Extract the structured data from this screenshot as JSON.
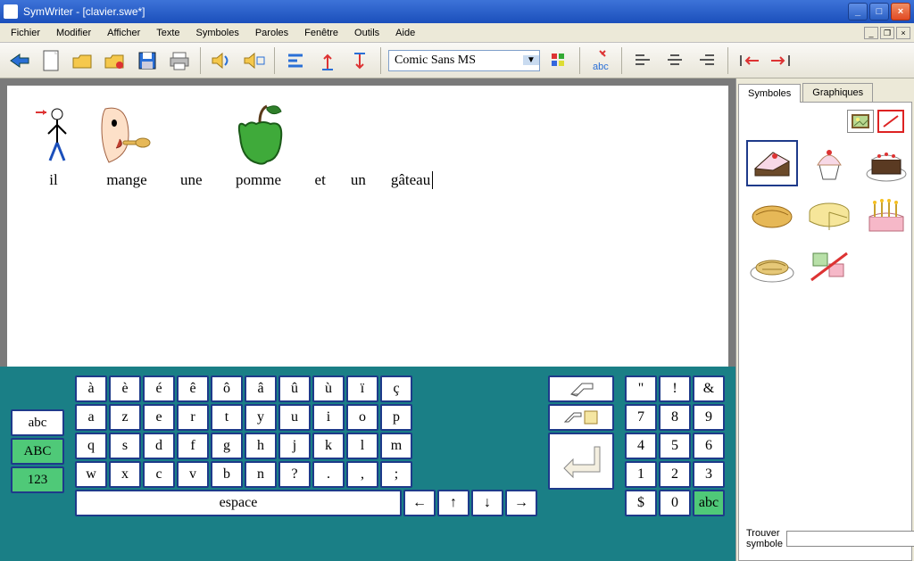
{
  "titlebar": {
    "app": "SymWriter",
    "doc": "[clavier.swe*]"
  },
  "menu": [
    "Fichier",
    "Modifier",
    "Afficher",
    "Texte",
    "Symboles",
    "Paroles",
    "Fenêtre",
    "Outils",
    "Aide"
  ],
  "toolbar": {
    "font": "Comic Sans MS"
  },
  "sentence": {
    "words": [
      {
        "text": "il",
        "icon": "person"
      },
      {
        "text": "mange",
        "icon": "eat"
      },
      {
        "text": "une",
        "icon": ""
      },
      {
        "text": "pomme",
        "icon": "apple"
      },
      {
        "text": "et",
        "icon": ""
      },
      {
        "text": "un",
        "icon": ""
      },
      {
        "text": "gâteau",
        "icon": ""
      }
    ]
  },
  "keyboard": {
    "modes": {
      "abc": "abc",
      "ABC": "ABC",
      "123": "123"
    },
    "row_accents": [
      "à",
      "è",
      "é",
      "ê",
      "ô",
      "â",
      "û",
      "ù",
      "ï",
      "ç"
    ],
    "row1": [
      "a",
      "z",
      "e",
      "r",
      "t",
      "y",
      "u",
      "i",
      "o",
      "p"
    ],
    "row2": [
      "q",
      "s",
      "d",
      "f",
      "g",
      "h",
      "j",
      "k",
      "l",
      "m"
    ],
    "row3": [
      "w",
      "x",
      "c",
      "v",
      "b",
      "n",
      "?",
      ".",
      ",",
      ";"
    ],
    "space": "espace",
    "arrows": [
      "←",
      "↑",
      "↓",
      "→"
    ],
    "num_row0": [
      "\"",
      "!",
      "&"
    ],
    "num_row1": [
      "7",
      "8",
      "9"
    ],
    "num_row2": [
      "4",
      "5",
      "6"
    ],
    "num_row3": [
      "1",
      "2",
      "3"
    ],
    "num_row4": [
      "$",
      "0",
      "abc"
    ]
  },
  "sidepanel": {
    "tabs": [
      "Symboles",
      "Graphiques"
    ],
    "cells": [
      "cake-slice",
      "cupcake",
      "fancy-cake",
      "bread-roll",
      "cheese-wheel",
      "birthday-cake",
      "pie",
      "no-symbol"
    ],
    "search_label": "Trouver symbole",
    "search_value": ""
  }
}
